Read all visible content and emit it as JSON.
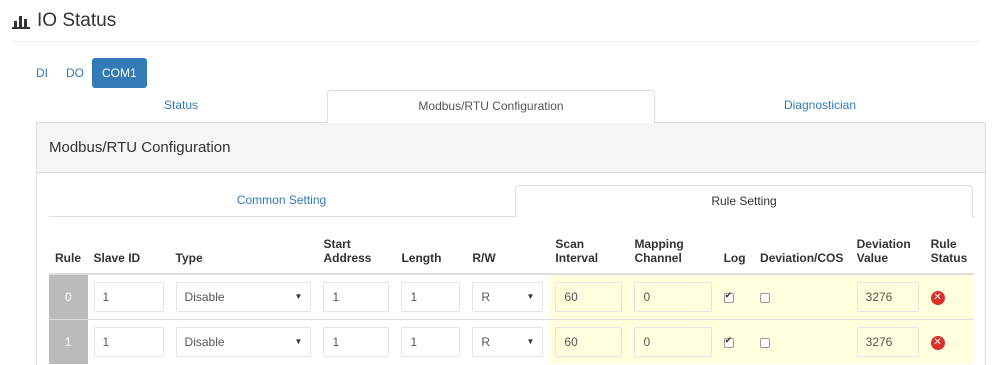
{
  "page": {
    "title": "IO Status"
  },
  "io_tabs": [
    {
      "label": "DI",
      "active": false
    },
    {
      "label": "DO",
      "active": false
    },
    {
      "label": "COM1",
      "active": true
    }
  ],
  "nav_tabs": [
    {
      "label": "Status",
      "active": false
    },
    {
      "label": "Modbus/RTU Configuration",
      "active": true
    },
    {
      "label": "Diagnostician",
      "active": false
    }
  ],
  "panel": {
    "heading": "Modbus/RTU Configuration",
    "sub_tabs": [
      {
        "label": "Common Setting",
        "active": false
      },
      {
        "label": "Rule Setting",
        "active": true
      }
    ]
  },
  "table": {
    "headers": {
      "rule": "Rule",
      "slave_id": "Slave ID",
      "type": "Type",
      "start_address_1": "Start",
      "start_address_2": "Address",
      "length": "Length",
      "rw": "R/W",
      "scan_interval_1": "Scan",
      "scan_interval_2": "Interval",
      "mapping_channel_1": "Mapping",
      "mapping_channel_2": "Channel",
      "log": "Log",
      "deviation_cos": "Deviation/COS",
      "deviation_value_1": "Deviation",
      "deviation_value_2": "Value",
      "rule_status_1": "Rule",
      "rule_status_2": "Status"
    },
    "rows": [
      {
        "rule": "0",
        "slave_id": "1",
        "type": "Disable",
        "start_address": "1",
        "length": "1",
        "rw": "R",
        "scan_interval": "60",
        "mapping_channel": "0",
        "log": true,
        "deviation_cos": false,
        "deviation_value": "3276",
        "status": "error"
      },
      {
        "rule": "1",
        "slave_id": "1",
        "type": "Disable",
        "start_address": "1",
        "length": "1",
        "rw": "R",
        "scan_interval": "60",
        "mapping_channel": "0",
        "log": true,
        "deviation_cos": false,
        "deviation_value": "3276",
        "status": "error"
      }
    ]
  },
  "icons": {
    "title_icon": "bar-chart-icon",
    "status_icon": "error-icon",
    "caret": "caret-down-icon"
  },
  "colors": {
    "primary": "#337ab7",
    "highlight": "#ffffdd",
    "error": "#d9302c"
  }
}
